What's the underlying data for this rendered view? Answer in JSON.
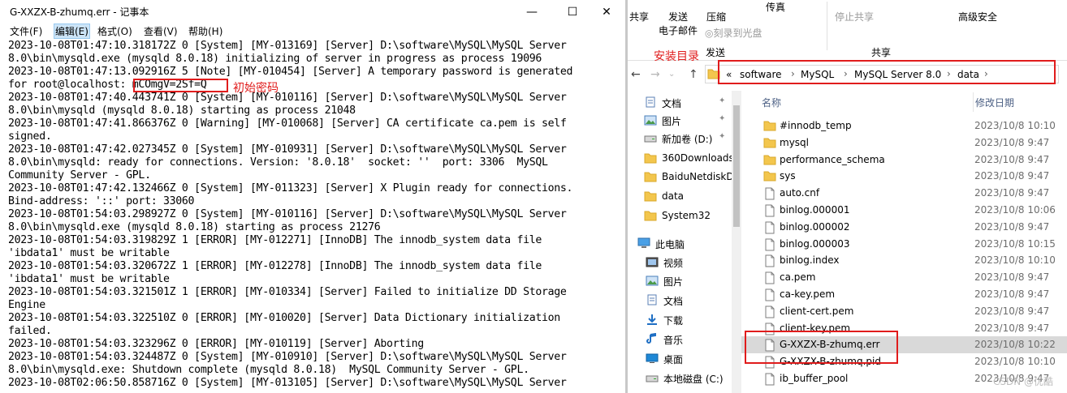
{
  "notepad": {
    "title": "G-XXZX-B-zhumq.err - 记事本",
    "controls": {
      "minimize": "—",
      "maximize": "☐",
      "close": "✕"
    },
    "menu": [
      "文件(F)",
      "编辑(E)",
      "格式(O)",
      "查看(V)",
      "帮助(H)"
    ],
    "lines": [
      "2023-10-08T01:47:10.318172Z 0 [System] [MY-013169] [Server] D:\\software\\MySQL\\MySQL Server",
      "8.0\\bin\\mysqld.exe (mysqld 8.0.18) initializing of server in progress as process 19096",
      "2023-10-08T01:47:13.092916Z 5 [Note] [MY-010454] [Server] A temporary password is generated",
      "for root@localhost: mCOmgV=2Sf=Q",
      "2023-10-08T01:47:40.443741Z 0 [System] [MY-010116] [Server] D:\\software\\MySQL\\MySQL Server",
      "8.0\\bin\\mysqld (mysqld 8.0.18) starting as process 21048",
      "2023-10-08T01:47:41.866376Z 0 [Warning] [MY-010068] [Server] CA certificate ca.pem is self",
      "signed.",
      "2023-10-08T01:47:42.027345Z 0 [System] [MY-010931] [Server] D:\\software\\MySQL\\MySQL Server",
      "8.0\\bin\\mysqld: ready for connections. Version: '8.0.18'  socket: ''  port: 3306  MySQL",
      "Community Server - GPL.",
      "2023-10-08T01:47:42.132466Z 0 [System] [MY-011323] [Server] X Plugin ready for connections.",
      "Bind-address: '::' port: 33060",
      "2023-10-08T01:54:03.298927Z 0 [System] [MY-010116] [Server] D:\\software\\MySQL\\MySQL Server",
      "8.0\\bin\\mysqld.exe (mysqld 8.0.18) starting as process 21276",
      "2023-10-08T01:54:03.319829Z 1 [ERROR] [MY-012271] [InnoDB] The innodb_system data file",
      "'ibdata1' must be writable",
      "2023-10-08T01:54:03.320672Z 1 [ERROR] [MY-012278] [InnoDB] The innodb_system data file",
      "'ibdata1' must be writable",
      "2023-10-08T01:54:03.321501Z 1 [ERROR] [MY-010334] [Server] Failed to initialize DD Storage",
      "Engine",
      "2023-10-08T01:54:03.322510Z 0 [ERROR] [MY-010020] [Server] Data Dictionary initialization",
      "failed.",
      "2023-10-08T01:54:03.323296Z 0 [ERROR] [MY-010119] [Server] Aborting",
      "2023-10-08T01:54:03.324487Z 0 [System] [MY-010910] [Server] D:\\software\\MySQL\\MySQL Server",
      "8.0\\bin\\mysqld.exe: Shutdown complete (mysqld 8.0.18)  MySQL Community Server - GPL.",
      "2023-10-08T02:06:50.858716Z 0 [System] [MY-013105] [Server] D:\\software\\MySQL\\MySQL Server"
    ],
    "password_annotation": "初始密码"
  },
  "explorer": {
    "ribbon": {
      "share": "共享",
      "send_line1": "发送",
      "send_line2": "电子邮件",
      "zip": "压缩",
      "burn": "刻录到光盘",
      "fax": "传真",
      "send_partial": "发送",
      "stop_share": "停止共享",
      "advanced_security": "高级安全",
      "group_share": "共享"
    },
    "annotation_install_dir": "安装目录",
    "breadcrumb": [
      "«",
      "software",
      "MySQL",
      "MySQL Server 8.0",
      "data"
    ],
    "nav_items": [
      {
        "label": "文档",
        "icon": "document-icon",
        "pinned": true
      },
      {
        "label": "图片",
        "icon": "picture-icon",
        "pinned": true
      },
      {
        "label": "新加卷 (D:)",
        "icon": "drive-icon",
        "pinned": true
      },
      {
        "label": "360Downloads",
        "icon": "folder-icon",
        "pinned": false
      },
      {
        "label": "BaiduNetdiskD",
        "icon": "folder-icon",
        "pinned": false
      },
      {
        "label": "data",
        "icon": "folder-icon",
        "pinned": false
      },
      {
        "label": "System32",
        "icon": "folder-icon",
        "pinned": false
      },
      {
        "label": "此电脑",
        "icon": "computer-icon",
        "pinned": false
      },
      {
        "label": "视频",
        "icon": "video-icon",
        "pinned": false
      },
      {
        "label": "图片",
        "icon": "picture-icon",
        "pinned": false
      },
      {
        "label": "文档",
        "icon": "document-icon",
        "pinned": false
      },
      {
        "label": "下载",
        "icon": "download-icon",
        "pinned": false
      },
      {
        "label": "音乐",
        "icon": "music-icon",
        "pinned": false
      },
      {
        "label": "桌面",
        "icon": "desktop-icon",
        "pinned": false
      },
      {
        "label": "本地磁盘 (C:)",
        "icon": "drive-icon",
        "pinned": false
      }
    ],
    "columns": {
      "name": "名称",
      "modified": "修改日期"
    },
    "files": [
      {
        "name": "#innodb_temp",
        "date": "2023/10/8 10:10",
        "type": "folder"
      },
      {
        "name": "mysql",
        "date": "2023/10/8 9:47",
        "type": "folder"
      },
      {
        "name": "performance_schema",
        "date": "2023/10/8 9:47",
        "type": "folder"
      },
      {
        "name": "sys",
        "date": "2023/10/8 9:47",
        "type": "folder"
      },
      {
        "name": "auto.cnf",
        "date": "2023/10/8 9:47",
        "type": "file"
      },
      {
        "name": "binlog.000001",
        "date": "2023/10/8 10:06",
        "type": "file"
      },
      {
        "name": "binlog.000002",
        "date": "2023/10/8 9:47",
        "type": "file"
      },
      {
        "name": "binlog.000003",
        "date": "2023/10/8 10:15",
        "type": "file"
      },
      {
        "name": "binlog.index",
        "date": "2023/10/8 10:10",
        "type": "file"
      },
      {
        "name": "ca.pem",
        "date": "2023/10/8 9:47",
        "type": "file"
      },
      {
        "name": "ca-key.pem",
        "date": "2023/10/8 9:47",
        "type": "file"
      },
      {
        "name": "client-cert.pem",
        "date": "2023/10/8 9:47",
        "type": "file"
      },
      {
        "name": "client-key.pem",
        "date": "2023/10/8 9:47",
        "type": "file"
      },
      {
        "name": "G-XXZX-B-zhumq.err",
        "date": "2023/10/8 10:22",
        "type": "file",
        "selected": true
      },
      {
        "name": "G-XXZX-B-zhumq.pid",
        "date": "2023/10/8 10:10",
        "type": "file"
      },
      {
        "name": "ib_buffer_pool",
        "date": "2023/10/8 9:47",
        "type": "file"
      }
    ],
    "watermark": "CSDN @优酷"
  },
  "colors": {
    "annotation_red": "#e01c1c",
    "selection": "#d9d9d9",
    "folder": "#f3c64d"
  }
}
